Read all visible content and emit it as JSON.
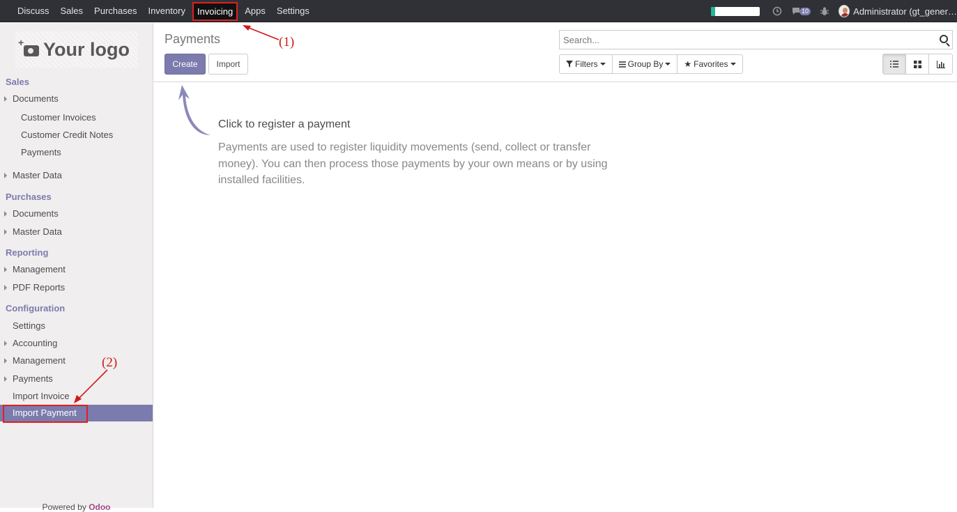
{
  "navbar": {
    "apps": [
      "Discuss",
      "Sales",
      "Purchases",
      "Inventory",
      "Invoicing",
      "Apps",
      "Settings"
    ],
    "active_app": "Invoicing",
    "messages_count": "10",
    "user": "Administrator (gt_gener…"
  },
  "sidebar": {
    "logo_text": "Your logo",
    "sales_header": "Sales",
    "sales_documents": "Documents",
    "customer_invoices": "Customer Invoices",
    "customer_credit_notes": "Customer Credit Notes",
    "payments_sub": "Payments",
    "sales_master_data": "Master Data",
    "purchases_header": "Purchases",
    "purchases_documents": "Documents",
    "purchases_master_data": "Master Data",
    "reporting_header": "Reporting",
    "reporting_management": "Management",
    "pdf_reports": "PDF Reports",
    "configuration_header": "Configuration",
    "settings": "Settings",
    "accounting": "Accounting",
    "config_management": "Management",
    "config_payments": "Payments",
    "import_invoice": "Import Invoice",
    "import_payment": "Import Payment",
    "powered_by": "Powered by",
    "odoo": "Odoo"
  },
  "control_panel": {
    "title": "Payments",
    "create_label": "Create",
    "import_label": "Import",
    "search_placeholder": "Search...",
    "filters_label": "Filters",
    "group_by_label": "Group By",
    "favorites_label": "Favorites"
  },
  "help": {
    "title": "Click to register a payment",
    "body": "Payments are used to register liquidity movements (send, collect or transfer money). You can then process those payments by your own means or by using installed facilities."
  },
  "annotations": {
    "label_1": "(1)",
    "label_2": "(2)"
  },
  "colors": {
    "primary": "#7c7bad",
    "navbar": "#2f3136",
    "highlight": "#e02020"
  },
  "progress_fraction": 0.08
}
